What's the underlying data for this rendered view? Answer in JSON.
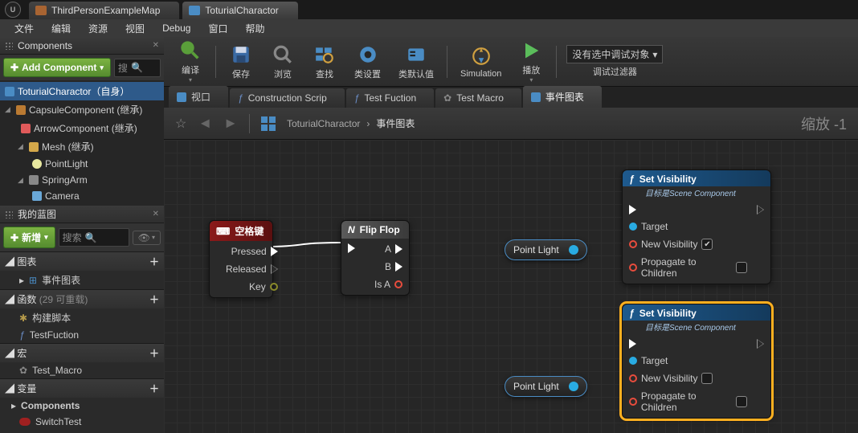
{
  "top_tabs": {
    "tab1": "ThirdPersonExampleMap",
    "tab2": "ToturialCharactor"
  },
  "menu": {
    "file": "文件",
    "edit": "编辑",
    "asset": "资源",
    "view": "视图",
    "debug": "Debug",
    "window": "窗口",
    "help": "帮助"
  },
  "components_panel": {
    "title": "Components",
    "add": "Add Component",
    "search_ph": "搜",
    "items": {
      "self": "ToturialCharactor（自身）",
      "capsule": "CapsuleComponent (继承)",
      "arrow": "ArrowComponent (继承)",
      "mesh": "Mesh (继承)",
      "pointlight": "PointLight",
      "springarm": "SpringArm",
      "camera": "Camera"
    }
  },
  "my_bp": {
    "title": "我的蓝图",
    "new": "新增",
    "search_ph": "搜索",
    "sections": {
      "graphs": "图表",
      "eventgraph": "事件图表",
      "functions": "函数",
      "functions_count": "(29 可重载)",
      "construct": "构建脚本",
      "testfn": "TestFuction",
      "macros": "宏",
      "testmacro": "Test_Macro",
      "variables": "变量",
      "components": "Components",
      "switchtest": "SwitchTest"
    }
  },
  "toolbar": {
    "compile": "编译",
    "save": "保存",
    "browse": "浏览",
    "find": "查找",
    "csettings": "类设置",
    "cdefaults": "类默认值",
    "sim": "Simulation",
    "play": "播放",
    "debug_none": "没有选中调试对象",
    "debug_filter": "调试过滤器"
  },
  "editor_tabs": {
    "viewport": "视口",
    "cs": "Construction Scrip",
    "tf": "Test Fuction",
    "tm": "Test Macro",
    "eg": "事件图表"
  },
  "breadcrumb": {
    "root": "ToturialCharactor",
    "sep": "›",
    "leaf": "事件图表",
    "zoom": "缩放 -1"
  },
  "nodes": {
    "space": {
      "title": "空格键",
      "pressed": "Pressed",
      "released": "Released",
      "key": "Key"
    },
    "flipflop": {
      "title": "Flip Flop",
      "a": "A",
      "b": "B",
      "isa": "Is A"
    },
    "setvis": {
      "title": "Set Visibility",
      "sub": "目标是Scene Component",
      "target": "Target",
      "newvis": "New Visibility",
      "prop": "Propagate to Children"
    },
    "pointlight": "Point Light"
  }
}
